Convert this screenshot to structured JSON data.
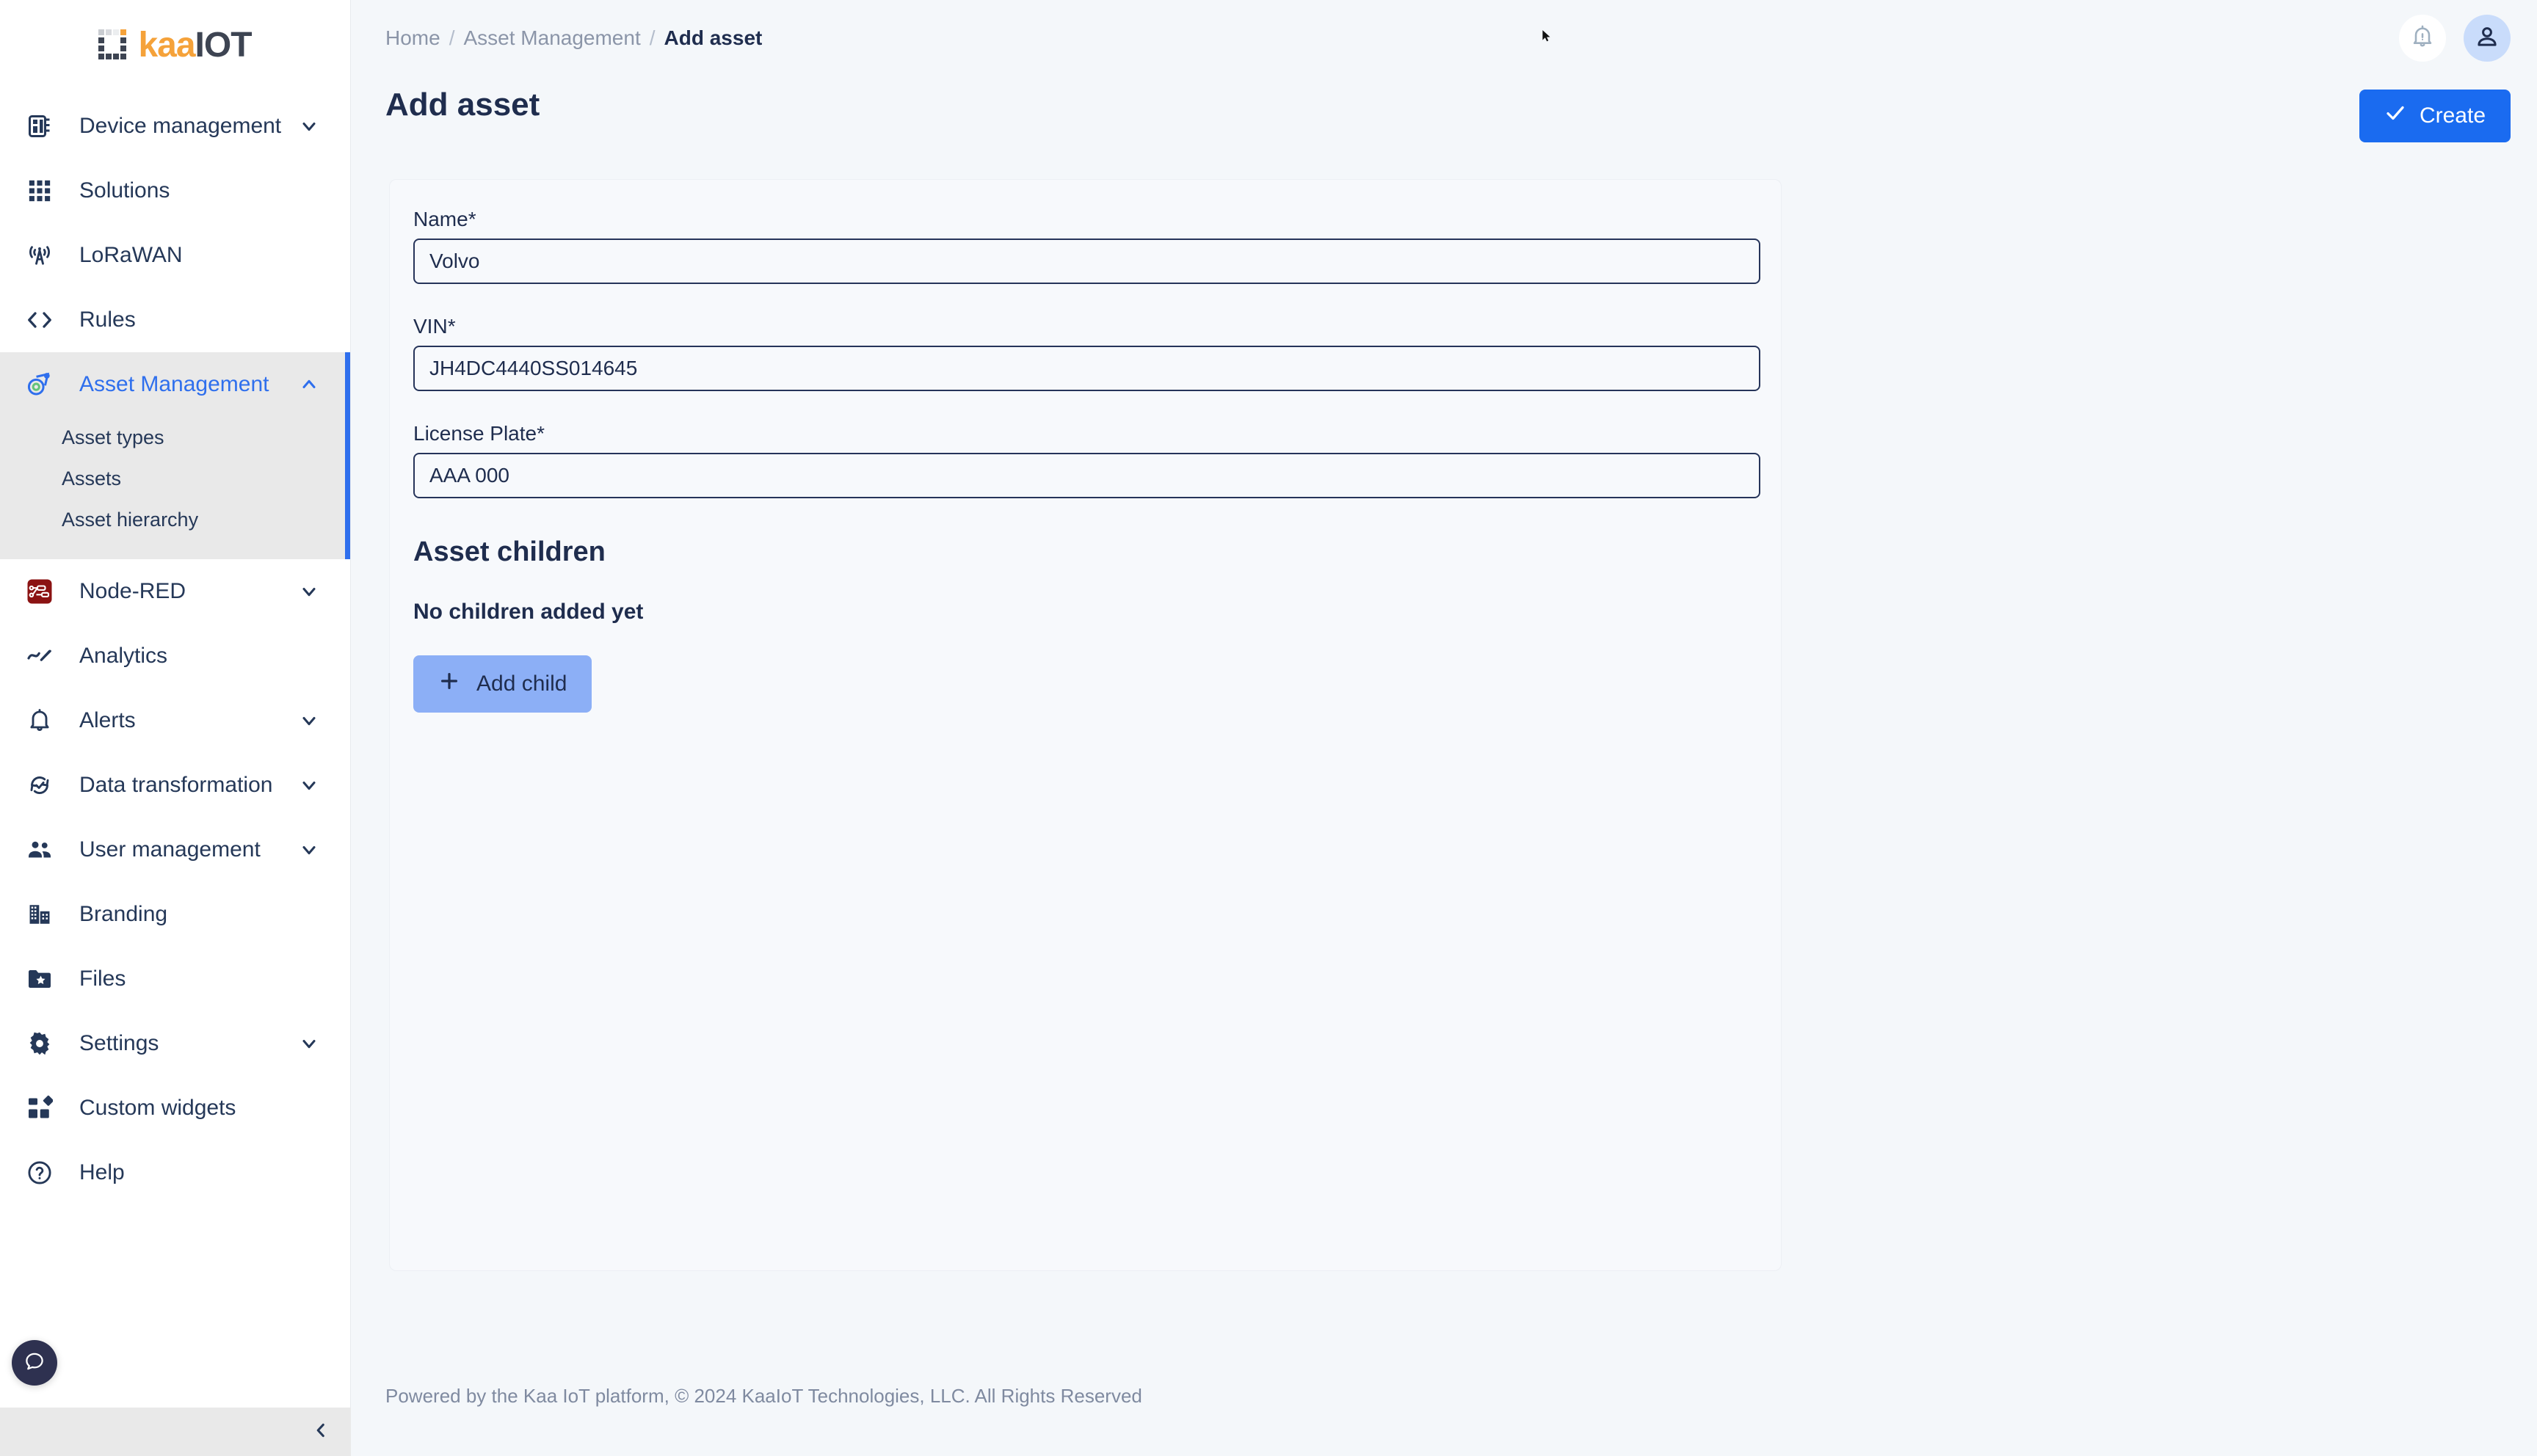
{
  "brand": {
    "logo_kaa": "kaa",
    "logo_iot": "IOT",
    "accent_orange": "#f5a23a",
    "accent_dark": "#3d4452",
    "accent_blue": "#1a6bf0"
  },
  "sidebar": {
    "items": [
      {
        "label": "Device management",
        "icon": "chip-icon",
        "expandable": true,
        "expanded": false
      },
      {
        "label": "Solutions",
        "icon": "grid-icon",
        "expandable": false
      },
      {
        "label": "LoRaWAN",
        "icon": "antenna-icon",
        "expandable": false
      },
      {
        "label": "Rules",
        "icon": "code-brackets-icon",
        "expandable": false
      },
      {
        "label": "Asset Management",
        "icon": "asset-tag-icon",
        "expandable": true,
        "expanded": true,
        "active": true
      },
      {
        "label": "Node-RED",
        "icon": "node-red-icon",
        "expandable": true,
        "expanded": false
      },
      {
        "label": "Analytics",
        "icon": "analytics-icon",
        "expandable": false
      },
      {
        "label": "Alerts",
        "icon": "bell-icon",
        "expandable": true,
        "expanded": false
      },
      {
        "label": "Data transformation",
        "icon": "sync-check-icon",
        "expandable": true,
        "expanded": false
      },
      {
        "label": "User management",
        "icon": "people-icon",
        "expandable": true,
        "expanded": false
      },
      {
        "label": "Branding",
        "icon": "building-icon",
        "expandable": false
      },
      {
        "label": "Files",
        "icon": "folder-star-icon",
        "expandable": false
      },
      {
        "label": "Settings",
        "icon": "gear-icon",
        "expandable": true,
        "expanded": false
      },
      {
        "label": "Custom widgets",
        "icon": "widgets-icon",
        "expandable": false
      },
      {
        "label": "Help",
        "icon": "question-circle-icon",
        "expandable": false
      }
    ],
    "asset_management_subitems": [
      {
        "label": "Asset types"
      },
      {
        "label": "Assets"
      },
      {
        "label": "Asset hierarchy"
      }
    ],
    "collapse_icon": "chevron-left-icon",
    "chat_icon": "chat-bubble-icon"
  },
  "header": {
    "breadcrumb": [
      {
        "label": "Home"
      },
      {
        "label": "Asset Management"
      },
      {
        "label": "Add asset"
      }
    ],
    "separator": "/",
    "notification_icon": "bell-alert-icon",
    "avatar_icon": "user-icon"
  },
  "page": {
    "title": "Add asset",
    "create_label": "Create",
    "create_icon": "check-icon"
  },
  "form": {
    "fields": [
      {
        "label": "Name",
        "required_marker": "*",
        "value": "Volvo",
        "placeholder": ""
      },
      {
        "label": "VIN",
        "required_marker": "*",
        "value": "JH4DC4440SS014645",
        "placeholder": ""
      },
      {
        "label": "License Plate",
        "required_marker": "*",
        "value": "AAA 000",
        "placeholder": ""
      }
    ]
  },
  "children_section": {
    "heading": "Asset children",
    "empty_text": "No children added yet",
    "add_label": "Add child",
    "add_icon": "plus-icon"
  },
  "footer": {
    "text": "Powered by the Kaa IoT platform, © 2024 KaaIoT Technologies, LLC. All Rights Reserved"
  }
}
